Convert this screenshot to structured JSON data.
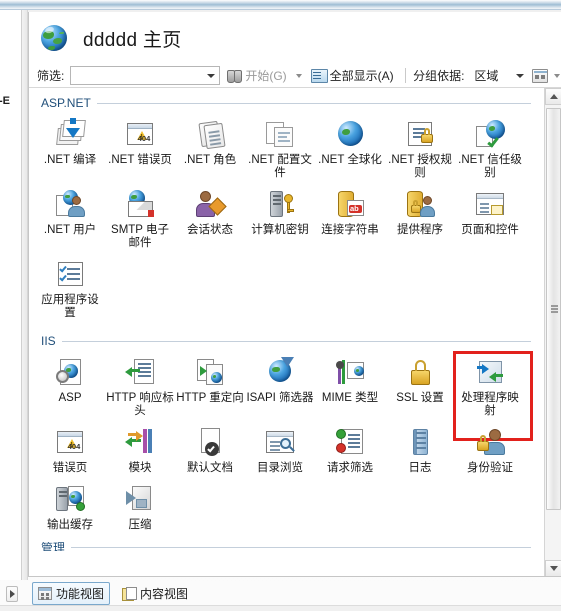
{
  "window": {
    "left_tree_partial_text": "N-E"
  },
  "header": {
    "icon": "globe-icon",
    "title": "ddddd 主页"
  },
  "toolbar": {
    "filter_label": "筛选:",
    "filter_value": "",
    "filter_placeholder": "",
    "start_button": "开始(G)",
    "start_button_icon": "binoculars-icon",
    "show_all_button": "全部显示(A)",
    "show_all_icon": "show-all-icon",
    "group_by_label": "分组依据:",
    "group_by_value": "区域",
    "view_icon": "view-mode-icon"
  },
  "groups": [
    {
      "name": "ASP.NET",
      "items": [
        {
          "label": ".NET 编译",
          "icon": "net-compilation-icon"
        },
        {
          "label": ".NET 错误页",
          "icon": "net-error-pages-icon"
        },
        {
          "label": ".NET 角色",
          "icon": "net-roles-icon"
        },
        {
          "label": ".NET 配置文件",
          "icon": "net-profile-icon"
        },
        {
          "label": ".NET 全球化",
          "icon": "net-globalization-icon"
        },
        {
          "label": ".NET 授权规则",
          "icon": "net-authorization-rules-icon"
        },
        {
          "label": ".NET 信任级别",
          "icon": "net-trust-levels-icon"
        },
        {
          "label": ".NET 用户",
          "icon": "net-users-icon"
        },
        {
          "label": "SMTP 电子邮件",
          "icon": "smtp-email-icon"
        },
        {
          "label": "会话状态",
          "icon": "session-state-icon"
        },
        {
          "label": "计算机密钥",
          "icon": "machine-key-icon"
        },
        {
          "label": "连接字符串",
          "icon": "connection-strings-icon"
        },
        {
          "label": "提供程序",
          "icon": "providers-icon"
        },
        {
          "label": "页面和控件",
          "icon": "pages-and-controls-icon"
        },
        {
          "label": "应用程序设置",
          "icon": "application-settings-icon"
        }
      ]
    },
    {
      "name": "IIS",
      "items": [
        {
          "label": "ASP",
          "icon": "asp-icon"
        },
        {
          "label": "HTTP 响应标头",
          "icon": "http-response-headers-icon"
        },
        {
          "label": "HTTP 重定向",
          "icon": "http-redirect-icon"
        },
        {
          "label": "ISAPI 筛选器",
          "icon": "isapi-filters-icon"
        },
        {
          "label": "MIME 类型",
          "icon": "mime-types-icon"
        },
        {
          "label": "SSL 设置",
          "icon": "ssl-settings-icon"
        },
        {
          "label": "处理程序映射",
          "icon": "handler-mappings-icon",
          "highlighted": true
        },
        {
          "label": "错误页",
          "icon": "error-pages-icon"
        },
        {
          "label": "模块",
          "icon": "modules-icon"
        },
        {
          "label": "默认文档",
          "icon": "default-document-icon"
        },
        {
          "label": "目录浏览",
          "icon": "directory-browsing-icon"
        },
        {
          "label": "请求筛选",
          "icon": "request-filtering-icon"
        },
        {
          "label": "日志",
          "icon": "logging-icon"
        },
        {
          "label": "身份验证",
          "icon": "authentication-icon"
        },
        {
          "label": "输出缓存",
          "icon": "output-caching-icon"
        },
        {
          "label": "压缩",
          "icon": "compression-icon"
        }
      ]
    }
  ],
  "clipped_group_name": "管理",
  "view_tabs": [
    {
      "label": "功能视图",
      "icon": "features-view-icon",
      "active": true
    },
    {
      "label": "内容视图",
      "icon": "content-view-icon",
      "active": false
    }
  ],
  "colors": {
    "highlight_box": "#e2211c",
    "group_header_text": "#1f4e79",
    "accent_blue": "#1477c4"
  },
  "scrollbar": {
    "up_arrow": "scroll-up-icon",
    "down_arrow": "scroll-down-icon"
  }
}
